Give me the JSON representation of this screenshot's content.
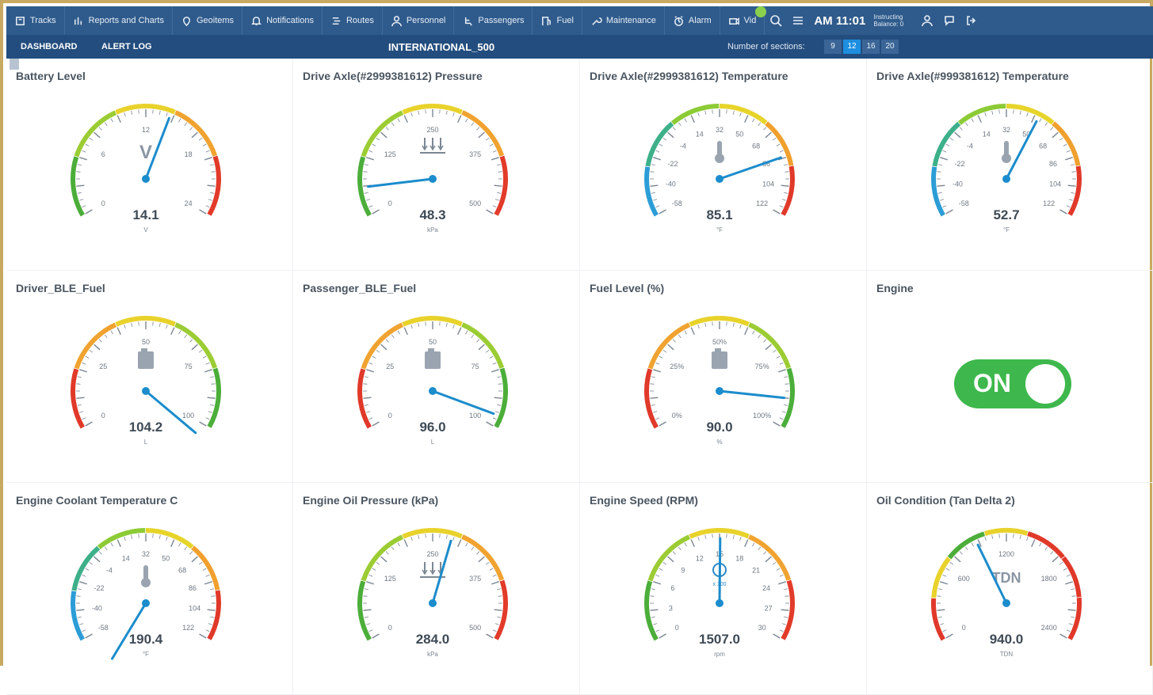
{
  "nav": {
    "items": [
      {
        "label": "Tracks",
        "icon": "tracks-icon"
      },
      {
        "label": "Reports and Charts",
        "icon": "reports-icon"
      },
      {
        "label": "Geoitems",
        "icon": "geoitems-icon"
      },
      {
        "label": "Notifications",
        "icon": "bell-icon"
      },
      {
        "label": "Routes",
        "icon": "routes-icon"
      },
      {
        "label": "Personnel",
        "icon": "person-icon"
      },
      {
        "label": "Passengers",
        "icon": "passenger-icon"
      },
      {
        "label": "Fuel",
        "icon": "fuel-icon"
      },
      {
        "label": "Maintenance",
        "icon": "wrench-icon"
      },
      {
        "label": "Alarm",
        "icon": "alarm-icon"
      },
      {
        "label": "Vid",
        "icon": "video-icon"
      }
    ],
    "time": "AM 11:01",
    "balance": "Instructing Balance: 0"
  },
  "subbar": {
    "tab_dashboard": "DASHBOARD",
    "tab_alert_log": "ALERT LOG",
    "title": "INTERNATIONAL_500",
    "sections_label": "Number of sections:",
    "sections": [
      "9",
      "12",
      "16",
      "20"
    ],
    "sections_active": "12"
  },
  "gauges": [
    {
      "title": "Battery Level",
      "value": "14.1",
      "unit": "V",
      "symbol": "V",
      "min": 0,
      "max": 24,
      "val": 14.1,
      "ticks": [
        "0",
        "6",
        "12",
        "18",
        "24"
      ],
      "colors": "gyr"
    },
    {
      "title": "Drive Axle(#2999381612) Pressure",
      "value": "48.3",
      "unit": "kPa",
      "symbol": "pressure",
      "min": 0,
      "max": 500,
      "val": 48.3,
      "ticks": [
        "0",
        "125",
        "250",
        "375",
        "500"
      ],
      "colors": "gyr"
    },
    {
      "title": "Drive Axle(#2999381612) Temperature",
      "value": "85.1",
      "unit": "°F",
      "symbol": "thermo",
      "min": -58,
      "max": 122,
      "val": 85.1,
      "ticks": [
        "-58",
        "-40",
        "-22",
        "-4",
        "14",
        "32",
        "50",
        "68",
        "86",
        "104",
        "122"
      ],
      "colors": "bgyr"
    },
    {
      "title": "Drive Axle(#999381612) Temperature",
      "value": "52.7",
      "unit": "°F",
      "symbol": "thermo",
      "min": -58,
      "max": 122,
      "val": 52.7,
      "ticks": [
        "-58",
        "-40",
        "-22",
        "-4",
        "14",
        "32",
        "50",
        "68",
        "86",
        "104",
        "122"
      ],
      "colors": "bgyr"
    },
    {
      "title": "Driver_BLE_Fuel",
      "value": "104.2",
      "unit": "L",
      "symbol": "fuel",
      "min": 0,
      "max": 100,
      "val": 104.2,
      "ticks": [
        "0",
        "25",
        "50",
        "75",
        "100"
      ],
      "colors": "ryg"
    },
    {
      "title": "Passenger_BLE_Fuel",
      "value": "96.0",
      "unit": "L",
      "symbol": "fuel",
      "min": 0,
      "max": 100,
      "val": 96.0,
      "ticks": [
        "0",
        "25",
        "50",
        "75",
        "100"
      ],
      "colors": "ryg"
    },
    {
      "title": "Fuel Level (%)",
      "value": "90.0",
      "unit": "%",
      "symbol": "fuel",
      "min": 0,
      "max": 100,
      "val": 90.0,
      "ticks": [
        "0%",
        "25%",
        "50%",
        "75%",
        "100%"
      ],
      "colors": "ryg"
    },
    {
      "title": "Engine Coolant Temperature C",
      "value": "190.4",
      "unit": "°F",
      "symbol": "thermo",
      "min": -58,
      "max": 122,
      "val": 190.4,
      "ticks": [
        "-58",
        "-40",
        "-22",
        "-4",
        "14",
        "32",
        "50",
        "68",
        "86",
        "104",
        "122"
      ],
      "colors": "bgyr"
    },
    {
      "title": "Engine Oil Pressure (kPa)",
      "value": "284.0",
      "unit": "kPa",
      "symbol": "pressure",
      "min": 0,
      "max": 500,
      "val": 284.0,
      "ticks": [
        "0",
        "125",
        "250",
        "375",
        "500"
      ],
      "colors": "gyr"
    },
    {
      "title": "Engine Speed (RPM)",
      "value": "1507.0",
      "unit": "rpm",
      "symbol": "rpm",
      "min": 0,
      "max": 30,
      "val": 15.07,
      "ticks": [
        "0",
        "3",
        "6",
        "9",
        "12",
        "15",
        "18",
        "21",
        "24",
        "27",
        "30"
      ],
      "colors": "gyr"
    },
    {
      "title": "Oil Condition (Tan Delta 2)",
      "value": "940.0",
      "unit": "TDN",
      "symbol": "TDN",
      "min": 0,
      "max": 2400,
      "val": 940,
      "ticks": [
        "0",
        "600",
        "1200",
        "1800",
        "2400"
      ],
      "colors": "tdn"
    }
  ],
  "engine": {
    "title": "Engine",
    "state": "ON"
  },
  "colors": {
    "nav_bg": "#2f5b8c",
    "sub_bg": "#234d7e",
    "frame": "#c8a961",
    "needle": "#1b8ccc",
    "on_green": "#3eb84c"
  }
}
